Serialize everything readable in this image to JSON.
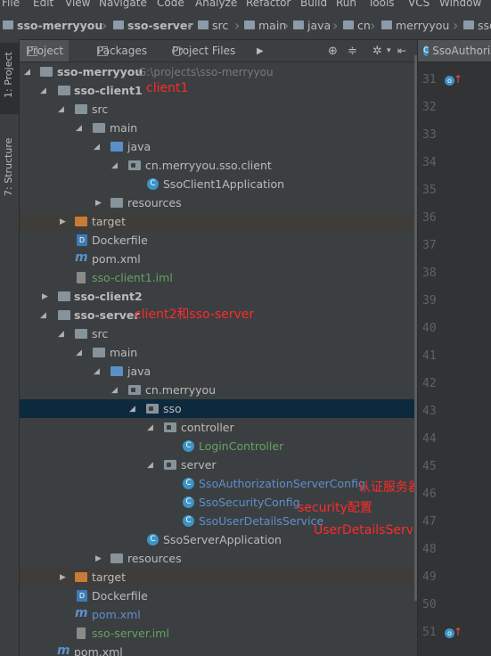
{
  "menu": [
    "File",
    "Edit",
    "View",
    "Navigate",
    "Code",
    "Analyze",
    "Refactor",
    "Build",
    "Run",
    "Tools",
    "VCS",
    "Window"
  ],
  "breadcrumb": [
    "sso-merryyou",
    "sso-server",
    "src",
    "main",
    "java",
    "cn",
    "merryyou",
    "sso"
  ],
  "left_tabs": {
    "project": "1: Project",
    "structure": "7: Structure"
  },
  "project_header": {
    "tabs": [
      "Project",
      "Packages",
      "Project Files"
    ]
  },
  "tree": {
    "root": {
      "label": "sso-merryyou",
      "path": "G:\\projects\\sso-merryyou"
    },
    "client1": {
      "label": "sso-client1",
      "src": "src",
      "main": "main",
      "java": "java",
      "pkg": "cn.merryyou.sso.client",
      "app": "SsoClient1Application",
      "resources": "resources",
      "target": "target",
      "dockerfile": "Dockerfile",
      "pom": "pom.xml",
      "iml": "sso-client1.iml"
    },
    "client2": {
      "label": "sso-client2"
    },
    "server": {
      "label": "sso-server",
      "src": "src",
      "main": "main",
      "java": "java",
      "pkg": "cn.merryyou",
      "sso": "sso",
      "controller": "controller",
      "login": "LoginController",
      "server": "server",
      "auth": "SsoAuthorizationServerConfig",
      "security": "SsoSecurityConfig",
      "userdetails": "SsoUserDetailsService",
      "app": "SsoServerApplication",
      "resources": "resources",
      "target": "target",
      "dockerfile": "Dockerfile",
      "pom": "pom.xml",
      "iml": "sso-server.iml"
    },
    "root_pom": "pom.xml"
  },
  "annotations": {
    "client1": "client1",
    "client2_server": "client2和sso-server",
    "auth": "认证服务器",
    "security": "security配置",
    "userdetails": "UserDetailsService"
  },
  "editor": {
    "tab": "SsoAuthorizationServerConfig",
    "lines": [
      "31",
      "32",
      "33",
      "34",
      "35",
      "36",
      "37",
      "38",
      "39",
      "40",
      "41",
      "42",
      "43",
      "44",
      "45",
      "46",
      "47",
      "48",
      "49",
      "50",
      "51"
    ]
  },
  "colors": {
    "selection": "#0d293e",
    "annotation": "#ff2a2a",
    "panel": "#3c3f41"
  }
}
